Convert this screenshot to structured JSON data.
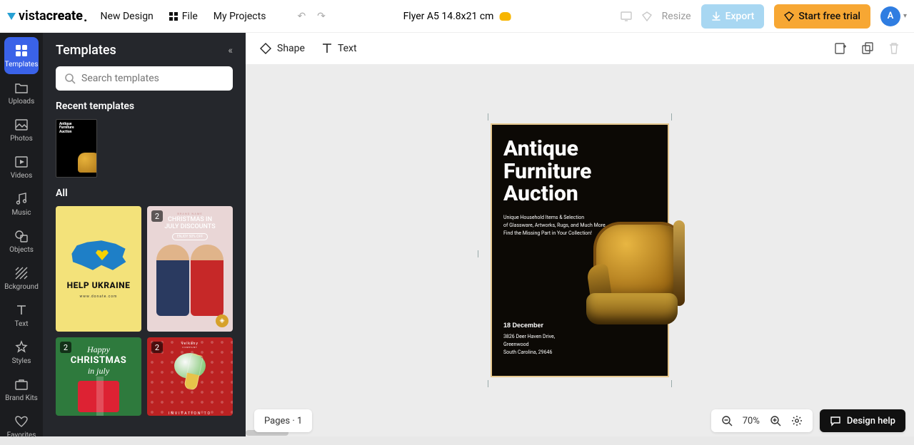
{
  "brand": {
    "name": "vista",
    "name2": "create",
    "dot": "."
  },
  "topnav": {
    "new_design": "New Design",
    "file": "File",
    "my_projects": "My Projects"
  },
  "document_title": "Flyer A5 14.8x21 cm",
  "top_right": {
    "resize": "Resize",
    "export": "Export",
    "start_trial": "Start free trial",
    "avatar_initial": "A"
  },
  "rail": {
    "templates": "Templates",
    "uploads": "Uploads",
    "photos": "Photos",
    "videos": "Videos",
    "music": "Music",
    "objects": "Objects",
    "background": "Bckground",
    "text": "Text",
    "styles": "Styles",
    "brand_kits": "Brand Kits",
    "favorites": "Favorites"
  },
  "panel": {
    "title": "Templates",
    "search_placeholder": "Search templates",
    "recent_label": "Recent templates",
    "all_label": "All"
  },
  "recent_thumb": {
    "line1": "Antique",
    "line2": "Furniture",
    "line3": "Auction"
  },
  "templates_grid": {
    "t1": {
      "headline": "HELP UKRAINE",
      "sub": "www.donate.com"
    },
    "t2": {
      "brand": "BRAND NAME",
      "line1": "CHRISTMAS IN",
      "line2": "JULY DISCOUNTS",
      "pill": "ENJOY 50% OFF",
      "badge": "2"
    },
    "t3": {
      "l1": "Happy",
      "l2": "CHRISTMAS",
      "l3": "in july",
      "badge": "2"
    },
    "t4": {
      "brand": "velkany",
      "sub": "COMPANY",
      "inv": "INVITATION TO",
      "badge": "2"
    }
  },
  "canvas_toolbar": {
    "shape": "Shape",
    "text": "Text"
  },
  "artboard": {
    "title_l1": "Antique",
    "title_l2": "Furniture",
    "title_l3": "Auction",
    "desc_l1": "Unique Household Items & Selection",
    "desc_l2": "of Glassware,  Artworks, Rugs, and Much More.",
    "desc_l3": "Find the Missing Part  in Your Collection!",
    "date": "18 December",
    "addr_l1": "3826 Deer Haven Drive,",
    "addr_l2": "Greenwood",
    "addr_l3": "South Carolina, 29646"
  },
  "bottom": {
    "pages": "Pages · 1",
    "zoom": "70%",
    "design_help": "Design help"
  }
}
